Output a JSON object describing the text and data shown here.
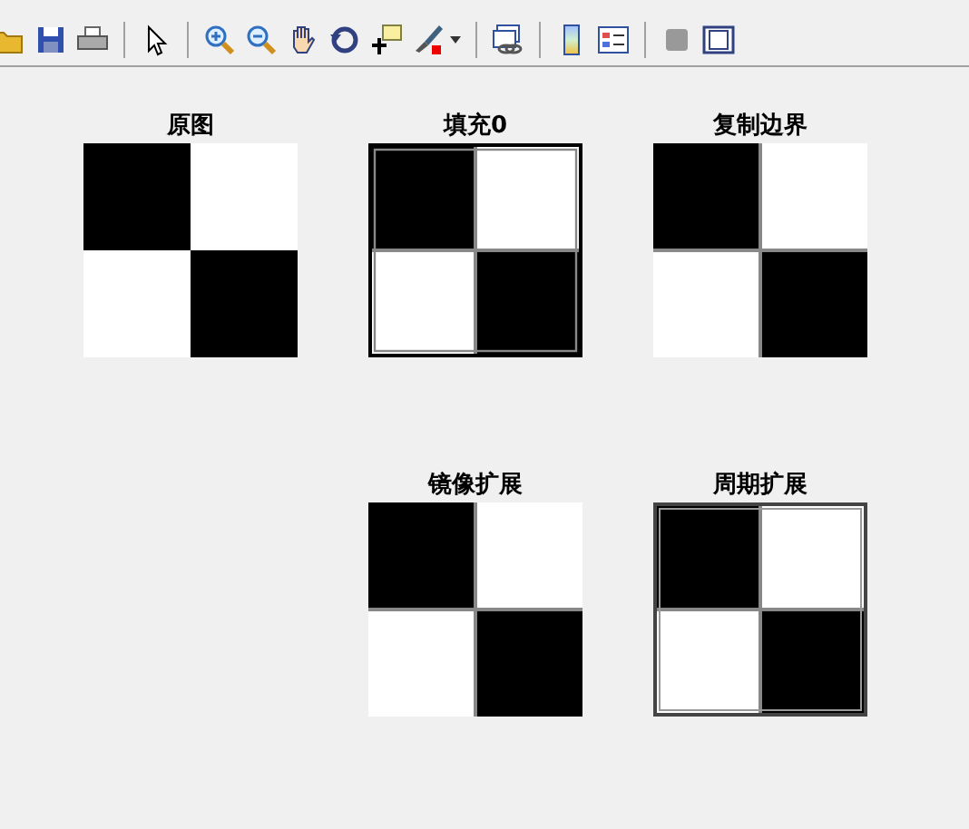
{
  "figure": {
    "rows": [
      {
        "plots": [
          {
            "title": "原图",
            "kind": "sharp"
          },
          {
            "title": "填充0",
            "kind": "zero"
          },
          {
            "title": "复制边界",
            "kind": "replicate"
          }
        ]
      },
      {
        "plots": [
          {
            "title": "镜像扩展",
            "kind": "symmetric"
          },
          {
            "title": "周期扩展",
            "kind": "circular"
          }
        ]
      }
    ]
  }
}
